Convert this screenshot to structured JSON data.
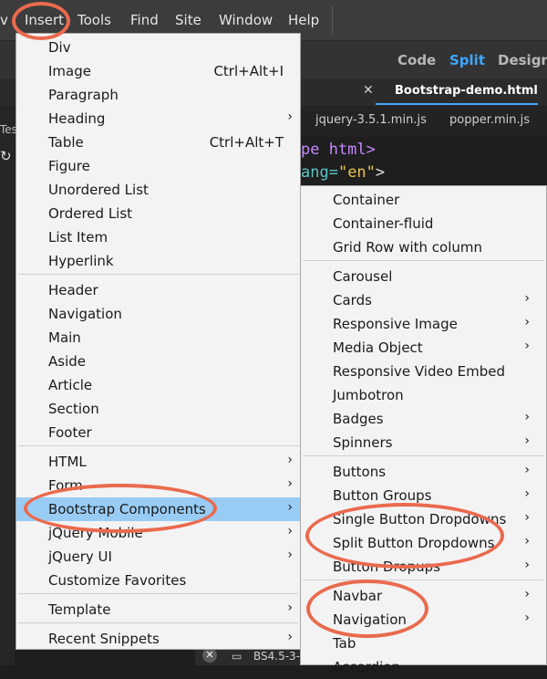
{
  "menubar": {
    "left_fragment": "v",
    "items": [
      "Insert",
      "Tools",
      "Find",
      "Site",
      "Window",
      "Help"
    ]
  },
  "viewbar": {
    "code": "Code",
    "split": "Split",
    "design": "Design"
  },
  "tabs": {
    "close": "✕",
    "active": "Bootstrap-demo.html"
  },
  "subtabs": [
    "jquery-3.5.1.min.js",
    "popper.min.js"
  ],
  "left_panel": {
    "fragment": "Tes"
  },
  "code": {
    "line1": "pe html>",
    "line2_attr": "ang=",
    "line2_str": "\"en\"",
    "line2_end": ">"
  },
  "bottom": {
    "text": "BS4.5-3-"
  },
  "insert_menu": {
    "items": [
      {
        "label": "Div"
      },
      {
        "label": "Image",
        "shortcut": "Ctrl+Alt+I"
      },
      {
        "label": "Paragraph"
      },
      {
        "label": "Heading",
        "arrow": "›"
      },
      {
        "label": "Table",
        "shortcut": "Ctrl+Alt+T"
      },
      {
        "label": "Figure"
      },
      {
        "label": "Unordered List"
      },
      {
        "label": "Ordered List"
      },
      {
        "label": "List Item"
      },
      {
        "label": "Hyperlink"
      },
      {
        "label": "Header"
      },
      {
        "label": "Navigation"
      },
      {
        "label": "Main"
      },
      {
        "label": "Aside"
      },
      {
        "label": "Article"
      },
      {
        "label": "Section"
      },
      {
        "label": "Footer"
      },
      {
        "label": "HTML",
        "arrow": "›"
      },
      {
        "label": "Form",
        "arrow": "›"
      },
      {
        "label": "Bootstrap Components",
        "arrow": "›"
      },
      {
        "label": "jQuery Mobile",
        "arrow": "›"
      },
      {
        "label": "jQuery UI",
        "arrow": "›"
      },
      {
        "label": "Customize Favorites"
      },
      {
        "label": "Template",
        "arrow": "›"
      },
      {
        "label": "Recent Snippets",
        "arrow": "›"
      }
    ]
  },
  "bootstrap_submenu": {
    "items": [
      {
        "label": "Container"
      },
      {
        "label": "Container-fluid"
      },
      {
        "label": "Grid Row with column"
      },
      {
        "label": "Carousel"
      },
      {
        "label": "Cards",
        "arrow": "›"
      },
      {
        "label": "Responsive Image",
        "arrow": "›"
      },
      {
        "label": "Media Object",
        "arrow": "›"
      },
      {
        "label": "Responsive Video Embed"
      },
      {
        "label": "Jumbotron"
      },
      {
        "label": "Badges",
        "arrow": "›"
      },
      {
        "label": "Spinners",
        "arrow": "›"
      },
      {
        "label": "Buttons",
        "arrow": "›"
      },
      {
        "label": "Button Groups",
        "arrow": "›"
      },
      {
        "label": "Single Button Dropdowns",
        "arrow": "›"
      },
      {
        "label": "Split Button Dropdowns",
        "arrow": "›"
      },
      {
        "label": "Button Dropups",
        "arrow": "›"
      },
      {
        "label": "Navbar",
        "arrow": "›"
      },
      {
        "label": "Navigation",
        "arrow": "›"
      },
      {
        "label": "Tab"
      },
      {
        "label": "Accordion"
      }
    ]
  },
  "colors": {
    "highlight": "#99ccf5",
    "annotation": "#ea6a4e",
    "accent": "#3ea6ff"
  }
}
